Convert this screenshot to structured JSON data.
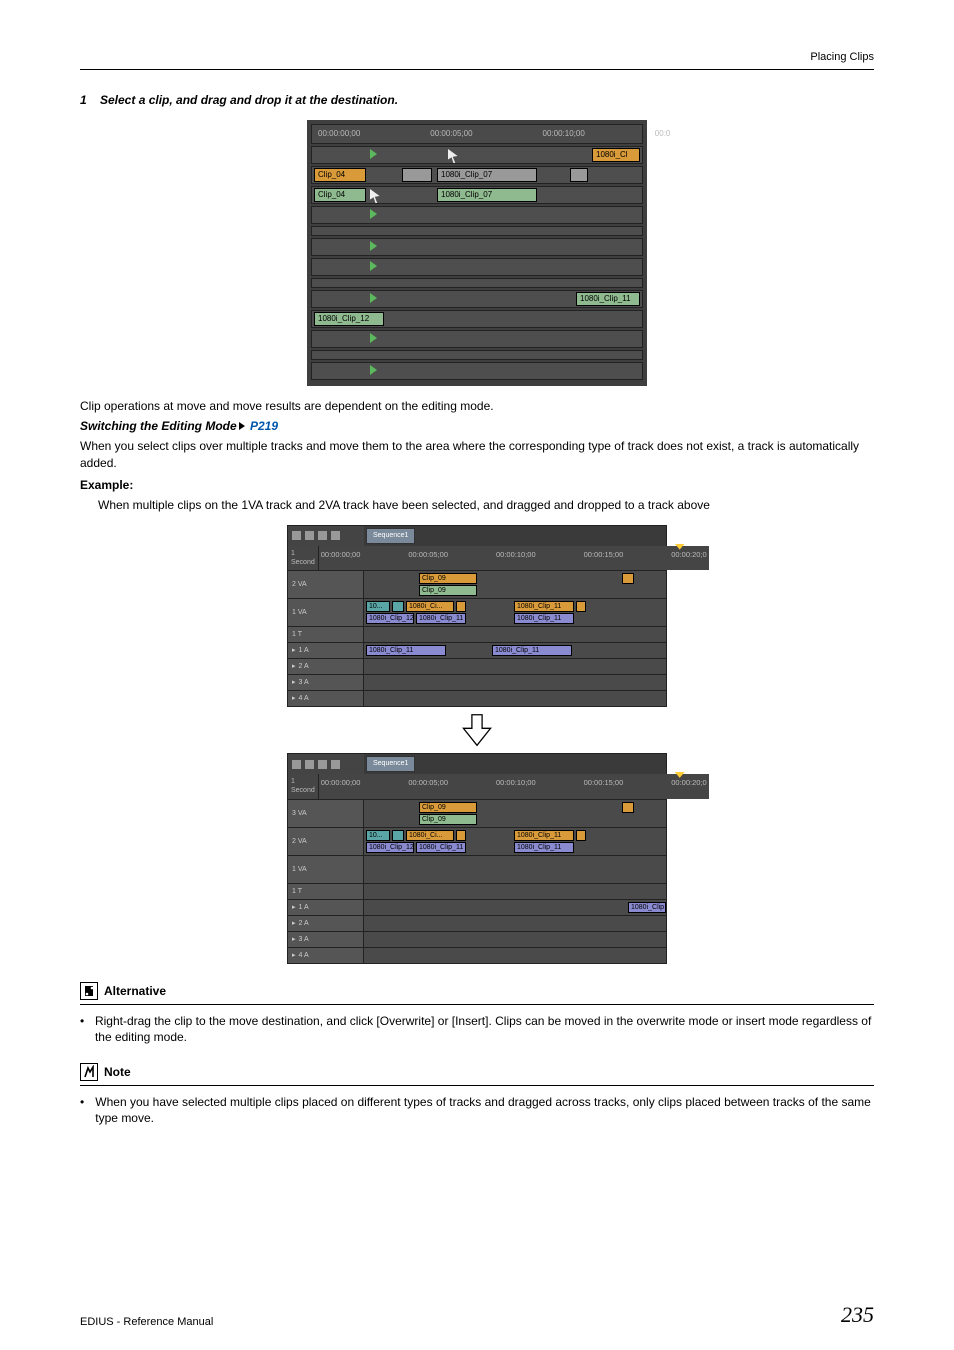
{
  "header": {
    "breadcrumb": "Placing Clips"
  },
  "step": {
    "number": "1",
    "text": "Select a clip, and drag and drop it at the destination."
  },
  "timeline1": {
    "ruler": [
      "00:00:00;00",
      "00:00:05;00",
      "00:00:10;00",
      "00:0"
    ],
    "clip_right_top": "1080i_Cl",
    "clip_04a": "Clip_04",
    "clip_07a": "1080i_Clip_07",
    "clip_04b": "Clip_04",
    "clip_07b": "1080i_Clip_07",
    "clip_11": "1080i_Clip_11",
    "clip_12": "1080i_Clip_12"
  },
  "para1": "Clip operations at move and move results are dependent on the editing mode.",
  "switching_label": "Switching the Editing Mode",
  "switching_ref": " P219",
  "para2": "When you select clips over multiple tracks and move them to the area where the corresponding type of track does not exist, a track is automatically added.",
  "example_label": "Example:",
  "example_text": "When multiple clips on the 1VA track and 2VA track have been selected, and dragged and dropped to a track above",
  "wide_timeline": {
    "sequence_tab": "Sequence1",
    "ruler": [
      "00:00:00;00",
      "00:00:05;00",
      "00:00:10;00",
      "00:00:15;00",
      "00:00:20;0"
    ],
    "scale_label": "1 Second",
    "rows_top": {
      "va2": "2 VA",
      "va1": "1 VA",
      "t1": "1 T",
      "a1": "1 A",
      "a2": "2 A",
      "a3": "3 A",
      "a4": "4 A"
    },
    "clips_top": {
      "clip_09a": "Clip_09",
      "clip_09b": "Clip_09",
      "c10": "10...",
      "c1080i_ci": "1080i_Ci...",
      "c1080i_clip_12": "1080i_Clip_12",
      "c1080i_clip_11a": "1080i_Clip_11",
      "c1080i_clip_11b": "1080i_Clip_11",
      "c1080i_clip_11c": "1080i_Clip_11",
      "a_clip_11a": "1080i_Clip_11",
      "a_clip_11b": "1080i_Clip_11"
    },
    "rows_bottom": {
      "va3": "3 VA",
      "va2": "2 VA",
      "va1": "1 VA",
      "t1": "1 T",
      "a1": "1 A",
      "a2": "2 A",
      "a3": "3 A",
      "a4": "4 A"
    },
    "clips_bottom": {
      "clip_09a": "Clip_09",
      "clip_09b": "Clip_09",
      "c10": "10...",
      "c1080i_ci": "1080i_Ci...",
      "c1080i_clip_12": "1080i_Clip_12",
      "c1080i_clip_11a": "1080i_Clip_11",
      "c1080i_clip_11b": "1080i_Clip_11",
      "c1080i_clip_11c": "1080i_Clip_11",
      "a_clip": "1080i_Clip"
    }
  },
  "alternative": {
    "title": "Alternative",
    "bullet": "Right-drag the clip to the move destination, and click [Overwrite] or [Insert]. Clips can be moved in the overwrite mode or insert mode regardless of the editing mode."
  },
  "note": {
    "title": "Note",
    "bullet": "When you have selected multiple clips placed on different types of tracks and dragged across tracks, only clips placed between tracks of the same type move."
  },
  "footer": {
    "left": "EDIUS - Reference Manual",
    "right": "235"
  }
}
